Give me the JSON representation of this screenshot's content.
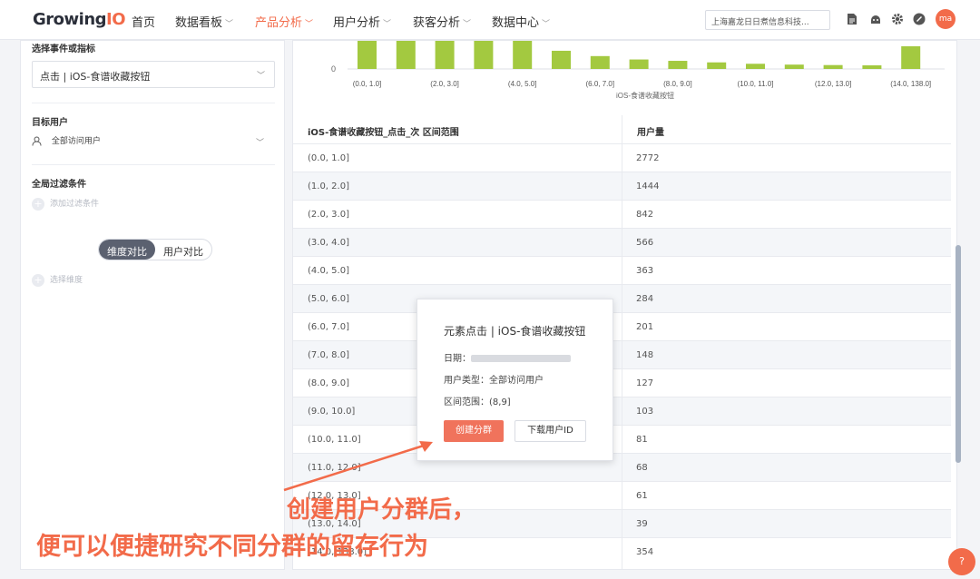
{
  "app": {
    "logo_main": "Growing",
    "logo_suffix": "IO"
  },
  "nav": [
    {
      "label": "首页",
      "chev": ""
    },
    {
      "label": "数据看板",
      "chev": "﹀"
    },
    {
      "label": "产品分析",
      "chev": "﹀"
    },
    {
      "label": "用户分析",
      "chev": "﹀"
    },
    {
      "label": "获客分析",
      "chev": "﹀"
    },
    {
      "label": "数据中心",
      "chev": "﹀"
    }
  ],
  "header": {
    "company": "上海嘉龙日日煮信息科技...",
    "avatar": "ma",
    "icons": [
      "document-icon",
      "android-icon",
      "gear-icon",
      "link-icon"
    ]
  },
  "left": {
    "event_title": "选择事件或指标",
    "event_value": "点击 | iOS-食谱收藏按钮",
    "target_title": "目标用户",
    "target_value": "全部访问用户",
    "filter_title": "全局过滤条件",
    "filter_add": "添加过滤条件",
    "compare_dim": "维度对比",
    "compare_user": "用户对比",
    "select_dim": "选择维度"
  },
  "chart_data": {
    "type": "bar",
    "xlabel": "iOS-食谱收藏按钮",
    "y_tick": "0",
    "categories": [
      "(0.0, 1.0]",
      "(1.0, 2.0]",
      "(2.0, 3.0]",
      "(3.0, 4.0]",
      "(4.0, 5.0]",
      "(5.0, 6.0]",
      "(6.0, 7.0]",
      "(7.0, 8.0]",
      "(8.0, 9.0]",
      "(9.0, 10.0]",
      "(10.0, 11.0]",
      "(11.0, 12.0]",
      "(12.0, 13.0]",
      "(13.0, 14.0]",
      "(14.0, 138.0]"
    ],
    "tick_labels": [
      "(0.0, 1.0]",
      "(2.0, 3.0]",
      "(4.0, 5.0]",
      "(6.0, 7.0]",
      "(8.0, 9.0]",
      "(10.0, 11.0]",
      "(12.0, 13.0]",
      "(14.0, 138.0]"
    ],
    "values": [
      2772,
      1444,
      842,
      566,
      363,
      284,
      201,
      148,
      127,
      103,
      81,
      68,
      61,
      39,
      354
    ],
    "color": "#a3c940"
  },
  "table": {
    "headers": [
      "iOS-食谱收藏按钮_点击_次 区间范围",
      "用户量"
    ],
    "rows": [
      [
        "(0.0, 1.0]",
        "2772"
      ],
      [
        "(1.0, 2.0]",
        "1444"
      ],
      [
        "(2.0, 3.0]",
        "842"
      ],
      [
        "(3.0, 4.0]",
        "566"
      ],
      [
        "(4.0, 5.0]",
        "363"
      ],
      [
        "(5.0, 6.0]",
        "284"
      ],
      [
        "(6.0, 7.0]",
        "201"
      ],
      [
        "(7.0, 8.0]",
        "148"
      ],
      [
        "(8.0, 9.0]",
        "127"
      ],
      [
        "(9.0, 10.0]",
        "103"
      ],
      [
        "(10.0, 11.0]",
        "81"
      ],
      [
        "(11.0, 12.0]",
        "68"
      ],
      [
        "(12.0, 13.0]",
        "61"
      ],
      [
        "(13.0, 14.0]",
        "39"
      ],
      [
        "(14.0, 138.0]",
        "354"
      ]
    ]
  },
  "popup": {
    "title": "元素点击 | iOS-食谱收藏按钮",
    "date_label": "日期：",
    "user_type": "用户类型：全部访问用户",
    "range": "区间范围：(8,9]",
    "create_btn": "创建分群",
    "download_btn": "下载用户ID"
  },
  "annotation": {
    "line1": "创建用户分群后，",
    "line2": "便可以便捷研究不同分群的留存行为",
    "color": "#f26b4a"
  },
  "help": "?"
}
